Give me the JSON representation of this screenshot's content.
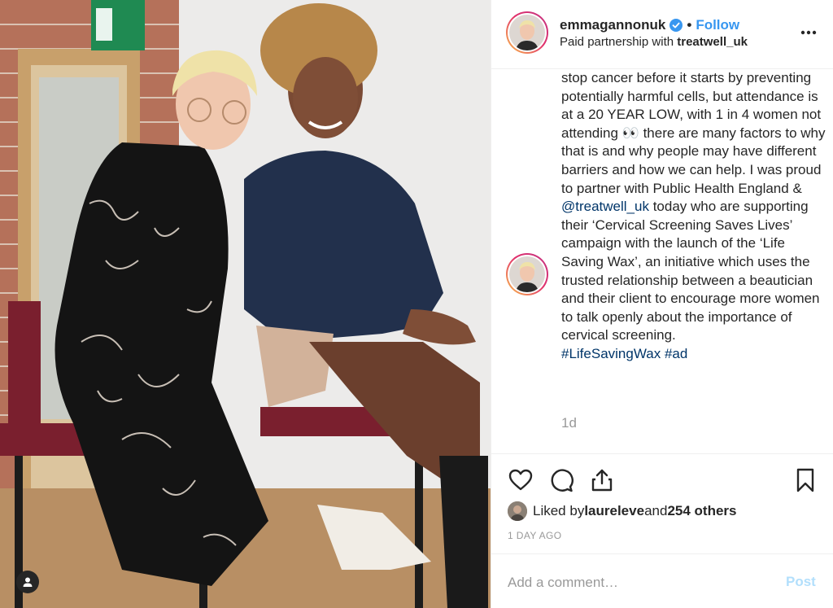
{
  "photo": {
    "alt_icon": "user-tag-icon"
  },
  "header": {
    "username": "emmagannonuk",
    "dot": "•",
    "follow_label": "Follow",
    "partnership_prefix": "Paid partnership with ",
    "partner_name": "treatwell_uk"
  },
  "caption": {
    "line1": "stop cancer before it starts by preventing potentially harmful cells, but attendance is at a 20 YEAR LOW, with 1 in 4 women not attending ",
    "eyes": "👀",
    "line2": " there are many factors to why that is and why people may have different barriers and how we can help. I was proud to partner with Public Health England & ",
    "mention": "@treatwell_uk",
    "line3": " today who are supporting their ‘Cervical Screening Saves Lives’ campaign with the launch of the ‘Life Saving Wax’, an initiative which uses the trusted relationship between a beautician and their client to encourage more women to talk openly about the importance of cervical screening.",
    "hashtag1": "#LifeSavingWax",
    "hashtag2": "#ad",
    "age": "1d"
  },
  "likes": {
    "prefix": "Liked by ",
    "user": "laureleve",
    "middle": " and ",
    "others": "254 others"
  },
  "timestamp": "1 DAY AGO",
  "comment": {
    "placeholder": "Add a comment…",
    "post_label": "Post"
  },
  "colors": {
    "link": "#3897f0",
    "hashtag": "#003569",
    "muted": "#999999",
    "post_disabled": "#b2dffc"
  }
}
